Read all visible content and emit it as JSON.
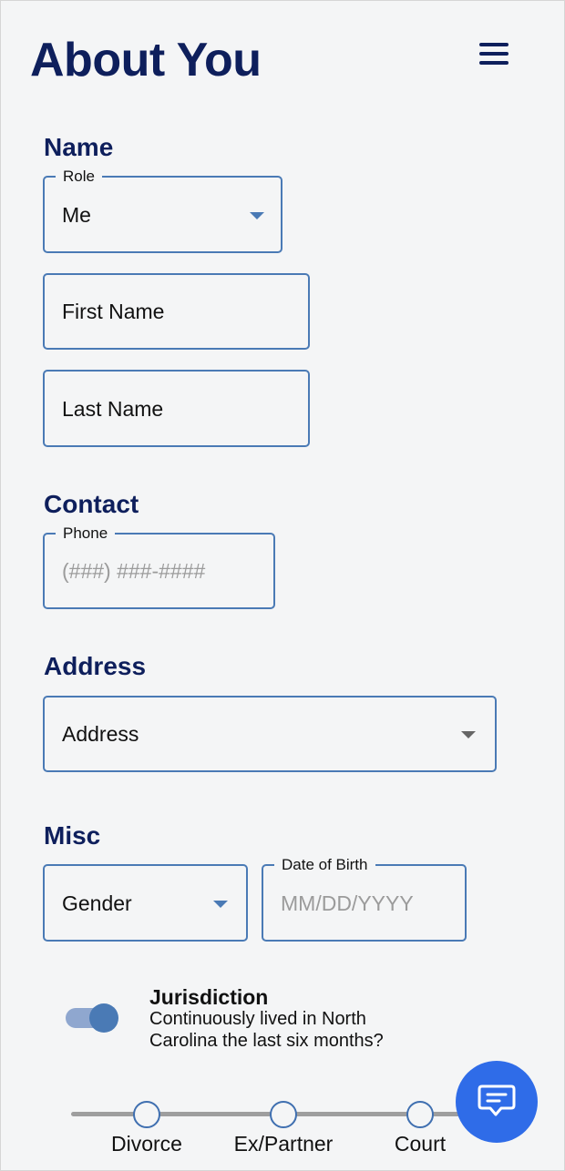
{
  "header": {
    "title": "About You",
    "menu_icon": "hamburger-menu-icon"
  },
  "sections": {
    "name": {
      "title": "Name",
      "role": {
        "legend": "Role",
        "value": "Me"
      },
      "first_name": {
        "placeholder": "First Name"
      },
      "last_name": {
        "placeholder": "Last Name"
      }
    },
    "contact": {
      "title": "Contact",
      "phone": {
        "legend": "Phone",
        "placeholder": "(###) ###-####"
      }
    },
    "address": {
      "title": "Address",
      "address": {
        "placeholder": "Address"
      }
    },
    "misc": {
      "title": "Misc",
      "gender": {
        "placeholder": "Gender"
      },
      "dob": {
        "legend": "Date of Birth",
        "placeholder": "MM/DD/YYYY"
      }
    }
  },
  "jurisdiction": {
    "title": "Jurisdiction",
    "text": "Continuously lived in North Carolina the last six months?",
    "toggle_on": true
  },
  "stepper": {
    "steps": [
      {
        "label": "Divorce"
      },
      {
        "label": "Ex/Partner"
      },
      {
        "label": "Court"
      }
    ]
  },
  "chat": {
    "icon": "chat-bubble-icon"
  },
  "colors": {
    "heading": "#0e1f5c",
    "field_border": "#4a7ab5",
    "accent": "#2f6ce8",
    "background": "#f4f5f6"
  }
}
